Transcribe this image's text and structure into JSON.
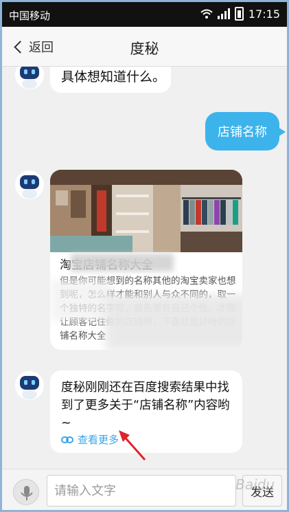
{
  "status_bar": {
    "carrier": "中国移动",
    "time": "17:15"
  },
  "nav": {
    "back_label": "返回",
    "title": "度秘"
  },
  "messages": {
    "bot_1": "具体想知道什么。",
    "user_1": "店铺名称",
    "card": {
      "title": "淘宝店铺名称大全",
      "desc": "但是你可能想到的名称其他的淘宝卖家也想到呢，怎么样才能和别人与众不同的，取一个独特的名字呢，首先要有自己个性，才能让顾客记住你的店铺啊，下面就是好听的店铺名称大全"
    },
    "bot_2": "度秘刚刚还在百度搜索结果中找到了更多关于“店铺名称”内容哟~",
    "see_more": "查看更多"
  },
  "input": {
    "placeholder": "请输入文字",
    "send_label": "发送"
  },
  "watermark": "Baidu",
  "colors": {
    "accent": "#3db3ec",
    "link": "#3aa4e8",
    "annotation_arrow": "#e0232b"
  }
}
